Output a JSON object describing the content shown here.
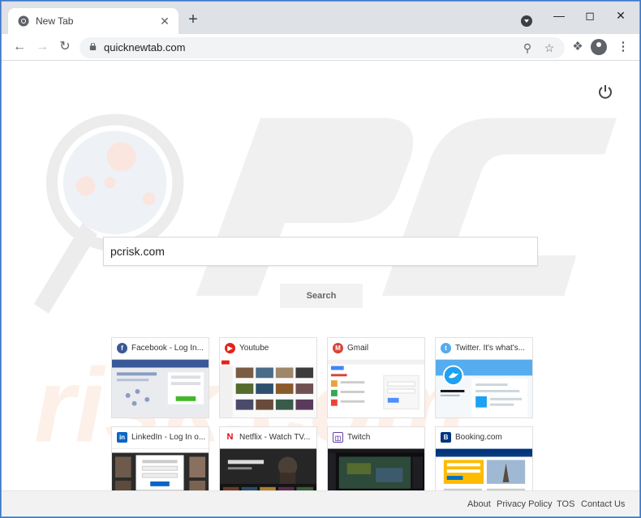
{
  "browser": {
    "tab_title": "New Tab",
    "url": "quicknewtab.com"
  },
  "search": {
    "value": "pcrisk.com",
    "button_label": "Search"
  },
  "tiles": [
    {
      "title": "Facebook - Log In...",
      "icon": "facebook-icon",
      "color": "#3b5998"
    },
    {
      "title": "Youtube",
      "icon": "youtube-icon",
      "color": "#e62117"
    },
    {
      "title": "Gmail",
      "icon": "gmail-icon",
      "color": "#d44638"
    },
    {
      "title": "Twitter. It's what's...",
      "icon": "twitter-icon",
      "color": "#55acee"
    },
    {
      "title": "LinkedIn - Log In o...",
      "icon": "linkedin-icon",
      "color": "#0a66c2"
    },
    {
      "title": "Netflix - Watch TV...",
      "icon": "netflix-icon",
      "color": "#e50914"
    },
    {
      "title": "Twitch",
      "icon": "twitch-icon",
      "color": "#6441a5"
    },
    {
      "title": "Booking.com",
      "icon": "booking-icon",
      "color": "#003580"
    }
  ],
  "footer": {
    "about": "About",
    "privacy": "Privacy Policy",
    "tos": "TOS",
    "contact": "Contact Us"
  }
}
